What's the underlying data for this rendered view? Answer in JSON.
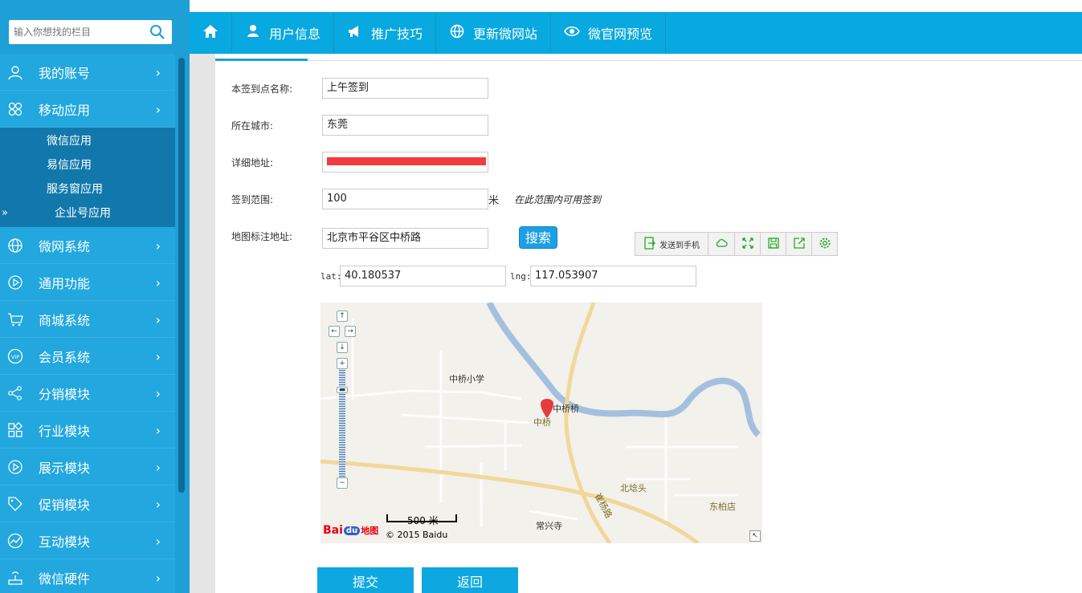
{
  "sidebar": {
    "search_placeholder": "输入你想找的栏目",
    "items": [
      {
        "label": "我的账号"
      },
      {
        "label": "移动应用"
      },
      {
        "label": "微网系统"
      },
      {
        "label": "通用功能"
      },
      {
        "label": "商城系统"
      },
      {
        "label": "会员系统"
      },
      {
        "label": "分销模块"
      },
      {
        "label": "行业模块"
      },
      {
        "label": "展示模块"
      },
      {
        "label": "促销模块"
      },
      {
        "label": "互动模块"
      },
      {
        "label": "微信硬件"
      }
    ],
    "submenu": [
      {
        "label": "微信应用"
      },
      {
        "label": "易信应用"
      },
      {
        "label": "服务窗应用"
      },
      {
        "label": "企业号应用"
      }
    ],
    "active_arrows": "»",
    "chevron": "›"
  },
  "topnav": {
    "items": [
      {
        "label": "用户信息"
      },
      {
        "label": "推广技巧"
      },
      {
        "label": "更新微网站"
      },
      {
        "label": "微官网预览"
      }
    ]
  },
  "form": {
    "name_label": "本签到点名称:",
    "name_value": "上午签到",
    "city_label": "所在城市:",
    "city_value": "东莞",
    "address_label": "详细地址:",
    "range_label": "签到范围:",
    "range_value": "100",
    "range_unit": "米",
    "range_hint": "在此范围内可用签到",
    "map_address_label": "地图标注地址:",
    "map_address_value": "北京市平谷区中桥路",
    "search_button": "搜索",
    "lat_label": "lat:",
    "lat_value": "40.180537",
    "lng_label": "lng:",
    "lng_value": "117.053907",
    "submit_button": "提交",
    "back_button": "返回"
  },
  "share_toolbar": {
    "send_to_phone": "发送到手机"
  },
  "map": {
    "labels": {
      "school": "中桥小学",
      "bridge": "中桥桥",
      "marker": "中桥",
      "beitai": "北埝头",
      "dongbai": "东柏店",
      "temple": "常兴寺",
      "road": "崔杨路"
    },
    "scale": "500 米",
    "copyright": "© 2015 Baidu",
    "logo_bai": "Bai",
    "logo_du": "du",
    "logo_map": "地图"
  }
}
